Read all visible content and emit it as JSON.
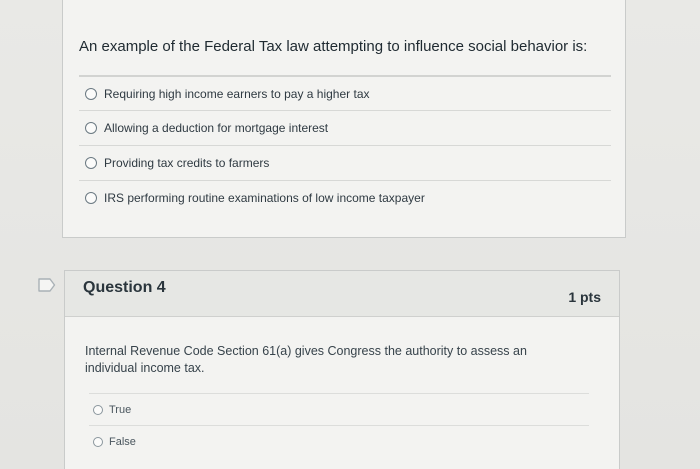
{
  "question3": {
    "text": "An example of the Federal Tax law attempting to influence social behavior is:",
    "answers": [
      {
        "label": "Requiring high income earners to pay a higher tax"
      },
      {
        "label": "Allowing a deduction for mortgage interest"
      },
      {
        "label": "Providing tax credits to farmers"
      },
      {
        "label": "IRS performing routine examinations of low income taxpayer"
      }
    ]
  },
  "question4": {
    "title": "Question 4",
    "points": "1 pts",
    "text": "Internal Revenue Code Section 61(a) gives Congress the authority to assess an individual income tax.",
    "answers": [
      {
        "label": "True"
      },
      {
        "label": "False"
      }
    ]
  },
  "icons": {
    "flag": "flag-question-icon"
  }
}
